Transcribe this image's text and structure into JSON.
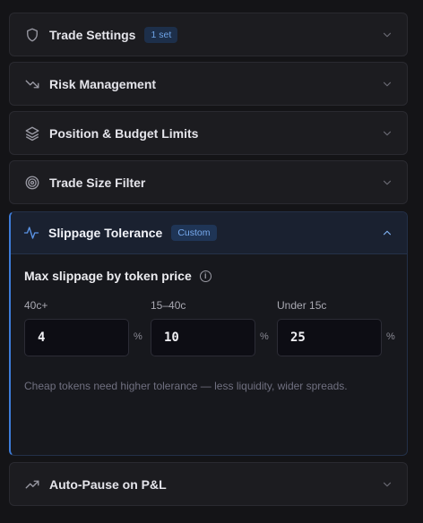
{
  "sections": [
    {
      "title": "Trade Settings",
      "badge": "1 set",
      "icon": "shield-icon"
    },
    {
      "title": "Risk Management",
      "icon": "trend-down-icon"
    },
    {
      "title": "Position & Budget Limits",
      "icon": "layers-icon"
    },
    {
      "title": "Trade Size Filter",
      "icon": "target-icon"
    }
  ],
  "slippage": {
    "title": "Slippage Tolerance",
    "badge": "Custom",
    "icon": "activity-icon",
    "subheading": "Max slippage by token price",
    "info_glyph": "i",
    "fields": [
      {
        "label": "40c+",
        "value": "4",
        "unit": "%"
      },
      {
        "label": "15–40c",
        "value": "10",
        "unit": "%"
      },
      {
        "label": "Under 15c",
        "value": "25",
        "unit": "%"
      }
    ],
    "hint": "Cheap tokens need higher tolerance — less liquidity, wider spreads."
  },
  "autopause": {
    "title": "Auto-Pause on P&L",
    "icon": "trend-up-icon"
  },
  "colors": {
    "accent": "#3d7cd9",
    "background": "#141417",
    "panel": "#1c1c20"
  }
}
